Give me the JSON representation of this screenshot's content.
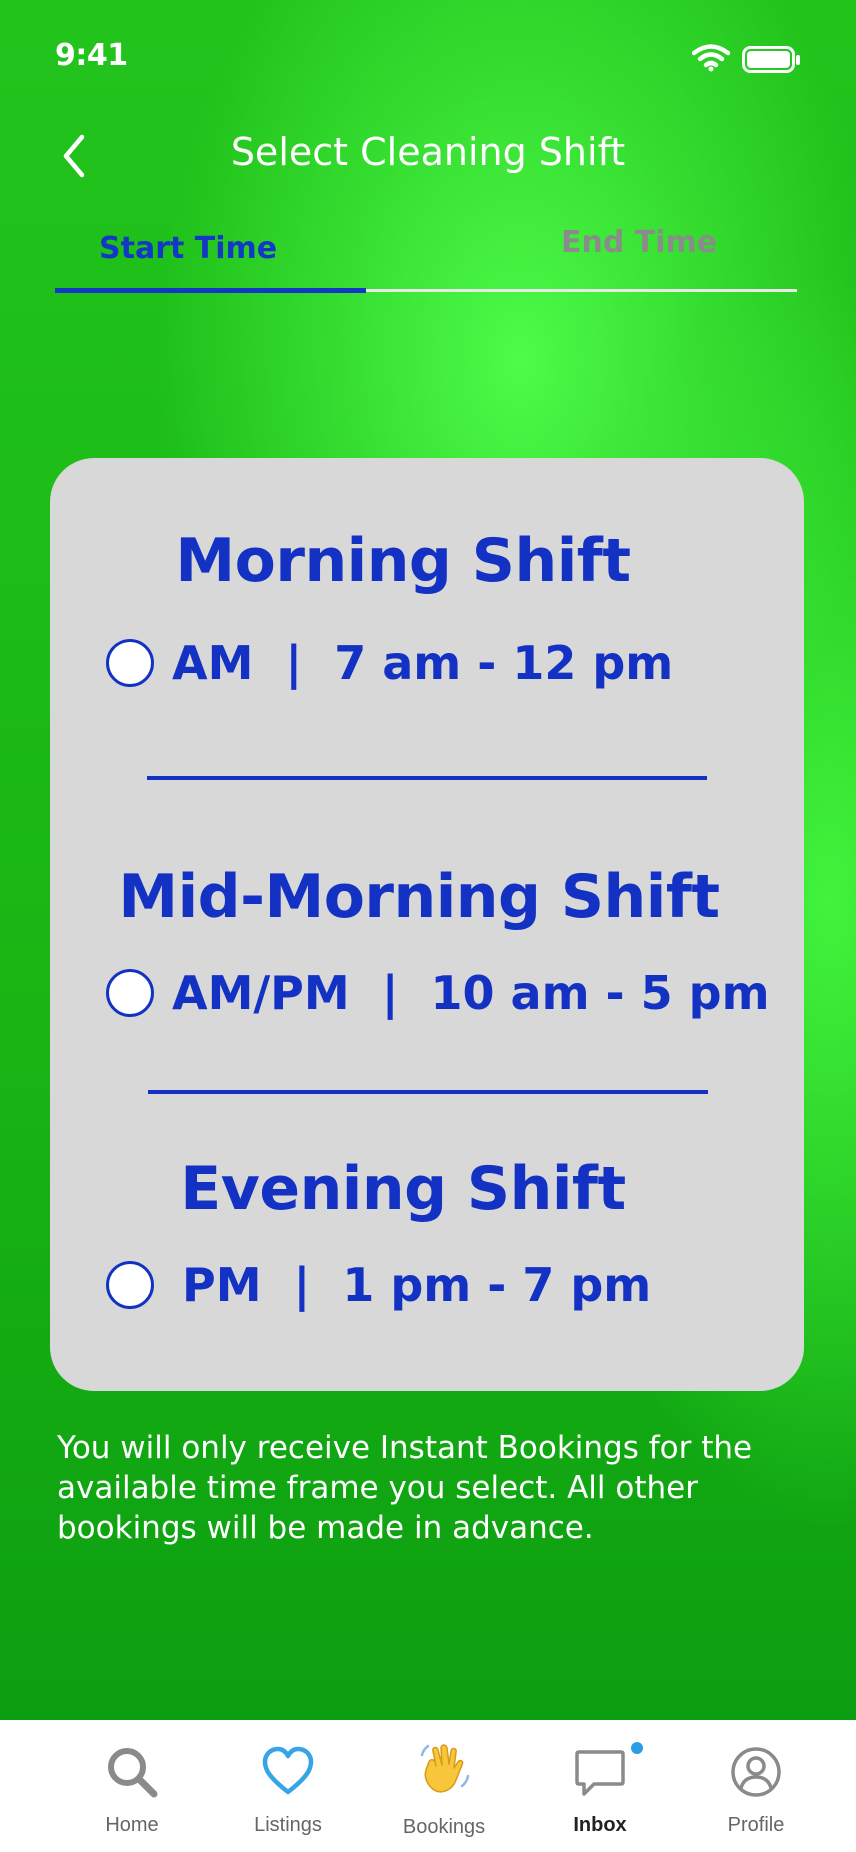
{
  "status_bar": {
    "time": "9:41"
  },
  "header": {
    "title": "Select Cleaning Shift"
  },
  "tabs": [
    {
      "label": "Start Time",
      "active": true
    },
    {
      "label": "End Time",
      "active": false
    }
  ],
  "shifts": [
    {
      "title": "Morning Shift",
      "option": "AM  |  7 am - 12 pm",
      "selected": false
    },
    {
      "title": "Mid-Morning Shift",
      "option": "AM/PM  |  10 am - 5 pm",
      "selected": false
    },
    {
      "title": "Evening Shift",
      "option": "PM  |  1 pm - 7 pm",
      "selected": false
    }
  ],
  "note": "You will only receive Instant Bookings for the available time frame you select. All other bookings will be made in advance.",
  "nav": [
    {
      "label": "Home",
      "icon": "search-icon"
    },
    {
      "label": "Listings",
      "icon": "heart-icon"
    },
    {
      "label": "Bookings",
      "icon": "waving-hand-icon"
    },
    {
      "label": "Inbox",
      "icon": "chat-bubble-icon",
      "active": true,
      "badge": true
    },
    {
      "label": "Profile",
      "icon": "user-circle-icon"
    }
  ],
  "colors": {
    "accent": "#1332C4",
    "background": "#1DBE17",
    "card": "#D8D8D8",
    "badge": "#2A9EE5"
  }
}
